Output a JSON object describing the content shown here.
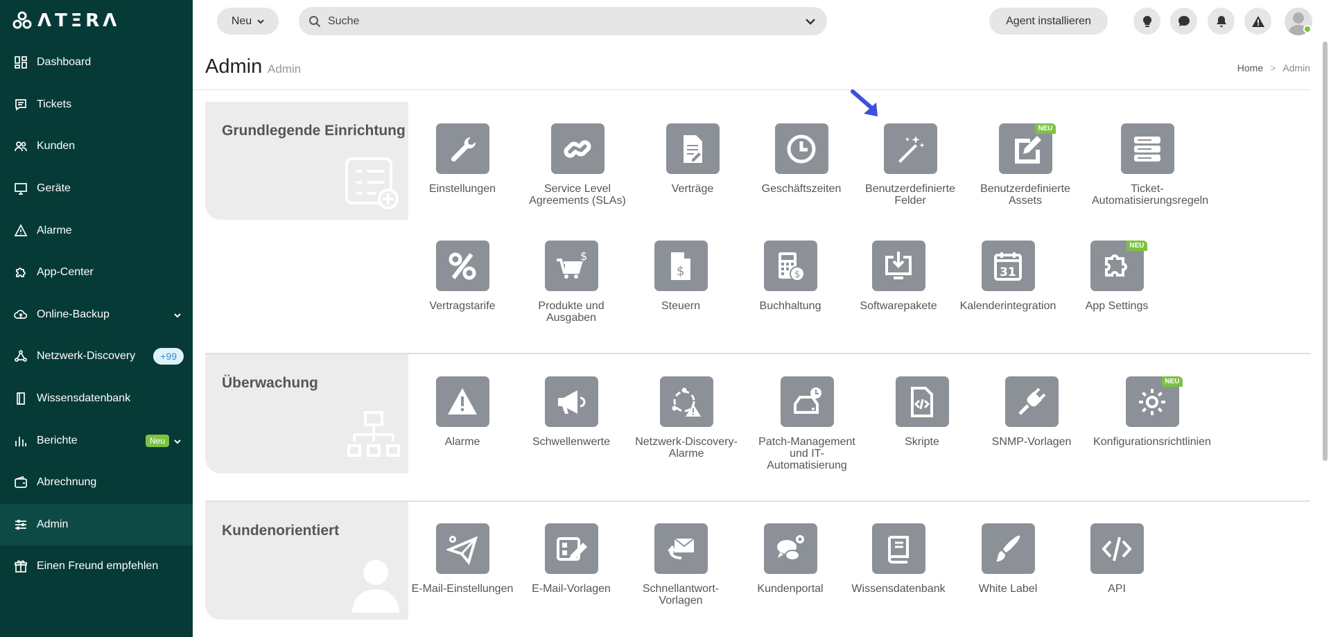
{
  "brand": {
    "logo_text": "ΛTΞRΛ"
  },
  "sidebar": {
    "items": [
      {
        "label": "Dashboard",
        "icon": "dashboard-icon"
      },
      {
        "label": "Tickets",
        "icon": "ticket-icon"
      },
      {
        "label": "Kunden",
        "icon": "users-icon"
      },
      {
        "label": "Geräte",
        "icon": "monitor-icon"
      },
      {
        "label": "Alarme",
        "icon": "warning-icon"
      },
      {
        "label": "App-Center",
        "icon": "puzzle-icon"
      },
      {
        "label": "Online-Backup",
        "icon": "cloud-icon"
      },
      {
        "label": "Netzwerk-Discovery",
        "icon": "network-icon",
        "badge": "+99"
      },
      {
        "label": "Wissensdatenbank",
        "icon": "book-icon"
      },
      {
        "label": "Berichte",
        "icon": "chart-icon",
        "badge": "Neu"
      },
      {
        "label": "Abrechnung",
        "icon": "wallet-icon"
      },
      {
        "label": "Admin",
        "icon": "sliders-icon",
        "active": true
      },
      {
        "label": "Einen Freund empfehlen",
        "icon": "gift-icon"
      }
    ]
  },
  "topbar": {
    "new_label": "Neu",
    "search_placeholder": "Suche",
    "agent_label": "Agent installieren",
    "icons": [
      "lightbulb-icon",
      "chat-icon",
      "bell-icon",
      "alert-icon"
    ]
  },
  "page": {
    "title": "Admin",
    "subtitle": "Admin",
    "breadcrumb": [
      "Home",
      ">",
      "Admin"
    ]
  },
  "sections": [
    {
      "title": "Grundlegende Einrichtung",
      "tiles": [
        {
          "label": "Einstellungen",
          "icon": "wrench-icon"
        },
        {
          "label": "Service Level Agreements (SLAs)",
          "icon": "link-icon"
        },
        {
          "label": "Verträge",
          "icon": "contract-icon"
        },
        {
          "label": "Geschäftszeiten",
          "icon": "clock-icon"
        },
        {
          "label": "Benutzerdefinierte Felder",
          "icon": "magic-wand-icon"
        },
        {
          "label": "Benutzerdefinierte Assets",
          "icon": "edit-doc-icon",
          "tag": "NEU"
        },
        {
          "label": "Ticket-Automatisierungsregeln",
          "icon": "server-icon"
        },
        {
          "label": "Vertragstarife",
          "icon": "percent-icon"
        },
        {
          "label": "Produkte und Ausgaben",
          "icon": "cart-icon"
        },
        {
          "label": "Steuern",
          "icon": "tax-doc-icon"
        },
        {
          "label": "Buchhaltung",
          "icon": "calculator-icon"
        },
        {
          "label": "Softwarepakete",
          "icon": "download-monitor-icon"
        },
        {
          "label": "Kalenderintegration",
          "icon": "calendar-icon"
        },
        {
          "label": "App Settings",
          "icon": "puzzle-icon",
          "tag": "NEU"
        }
      ]
    },
    {
      "title": "Überwachung",
      "tiles": [
        {
          "label": "Alarme",
          "icon": "warning-icon"
        },
        {
          "label": "Schwellenwerte",
          "icon": "megaphone-icon"
        },
        {
          "label": "Netzwerk-Discovery-Alarme",
          "icon": "network-alert-icon"
        },
        {
          "label": "Patch-Management und IT-Automatisierung",
          "icon": "drive-clock-icon"
        },
        {
          "label": "Skripte",
          "icon": "code-file-icon"
        },
        {
          "label": "SNMP-Vorlagen",
          "icon": "plug-icon"
        },
        {
          "label": "Konfigurationsrichtlinien",
          "icon": "gear-icon",
          "tag": "NEU"
        }
      ]
    },
    {
      "title": "Kundenorientiert",
      "tiles": [
        {
          "label": "E-Mail-Einstellungen",
          "icon": "send-gear-icon"
        },
        {
          "label": "E-Mail-Vorlagen",
          "icon": "template-edit-icon"
        },
        {
          "label": "Schnellantwort-Vorlagen",
          "icon": "reply-mail-icon"
        },
        {
          "label": "Kundenportal",
          "icon": "chat-gear-icon"
        },
        {
          "label": "Wissensdatenbank",
          "icon": "book-icon"
        },
        {
          "label": "White Label",
          "icon": "brush-icon"
        },
        {
          "label": "API",
          "icon": "code-icon"
        }
      ]
    }
  ],
  "colors": {
    "sidebar_bg": "#063a36",
    "tile_bg": "#8c9198",
    "accent_green": "#7cc242",
    "arrow_blue": "#3b4fe0"
  }
}
